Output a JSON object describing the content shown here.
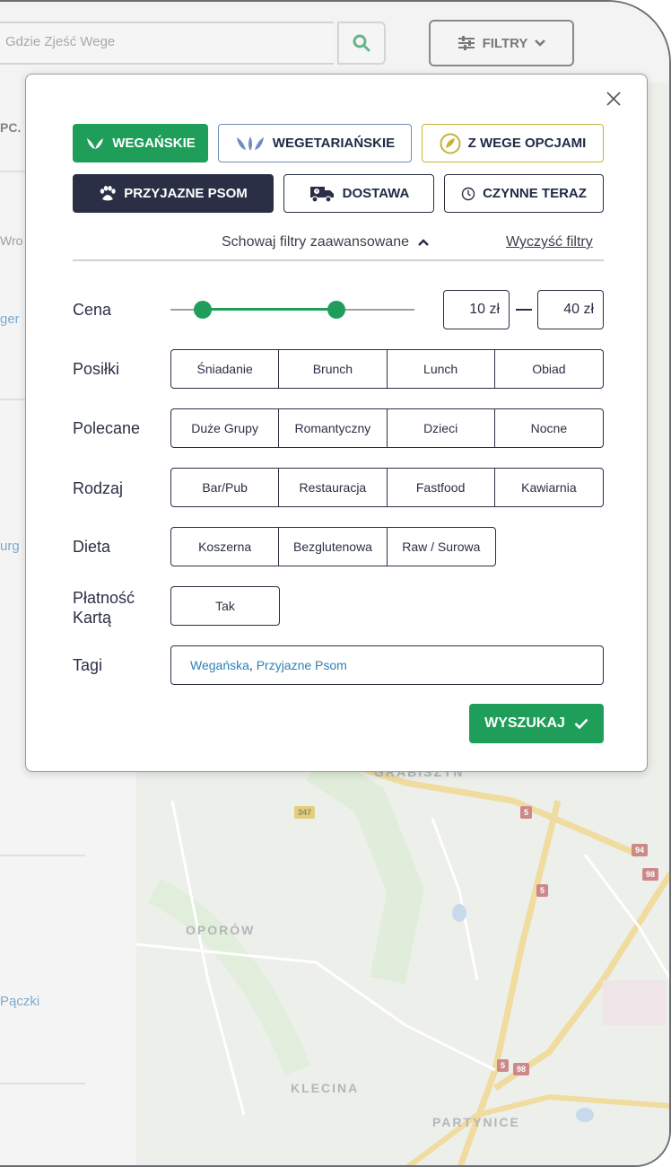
{
  "search": {
    "placeholder": "Gdzie Zjeść Wege"
  },
  "header": {
    "filters_label": "FILTRY"
  },
  "side": {
    "tab_fragment": "PC.",
    "item1": "Wro",
    "item2": "ger",
    "item3": "urg",
    "item4": "Pączki"
  },
  "map": {
    "labels": [
      "GRABISZYN",
      "OPORÓW",
      "KLECINA",
      "PARTYNICE"
    ],
    "shields": [
      "347",
      "5",
      "5",
      "94",
      "98",
      "5",
      "98"
    ]
  },
  "filters": {
    "chips": {
      "vegan": "WEGAŃSKIE",
      "vegetarian": "WEGETARIAŃSKIE",
      "vege_options": "Z WEGE OPCJAMI",
      "dog_friendly": "PRZYJAZNE PSOM",
      "delivery": "DOSTAWA",
      "open_now": "CZYNNE TERAZ"
    },
    "advanced_toggle": "Schowaj filtry zaawansowane",
    "clear": "Wyczyść filtry",
    "price": {
      "label": "Cena",
      "min": "10 zł",
      "max": "40 zł"
    },
    "meals": {
      "label": "Posiłki",
      "options": [
        "Śniadanie",
        "Brunch",
        "Lunch",
        "Obiad"
      ]
    },
    "recommended": {
      "label": "Polecane",
      "options": [
        "Duże Grupy",
        "Romantyczny",
        "Dzieci",
        "Nocne"
      ]
    },
    "type": {
      "label": "Rodzaj",
      "options": [
        "Bar/Pub",
        "Restauracja",
        "Fastfood",
        "Kawiarnia"
      ]
    },
    "diet": {
      "label": "Dieta",
      "options": [
        "Koszerna",
        "Bezglutenowa",
        "Raw / Surowa"
      ]
    },
    "card_payment": {
      "label_line1": "Płatność",
      "label_line2": "Kartą",
      "option": "Tak"
    },
    "tags": {
      "label": "Tagi",
      "tag1": "Wegańska",
      "separator": ", ",
      "tag2": "Przyjazne Psom"
    },
    "submit": "WYSZUKAJ"
  },
  "colors": {
    "green": "#1f9e5a",
    "navy": "#2a2f45",
    "tag_blue": "#2f7fb8"
  }
}
